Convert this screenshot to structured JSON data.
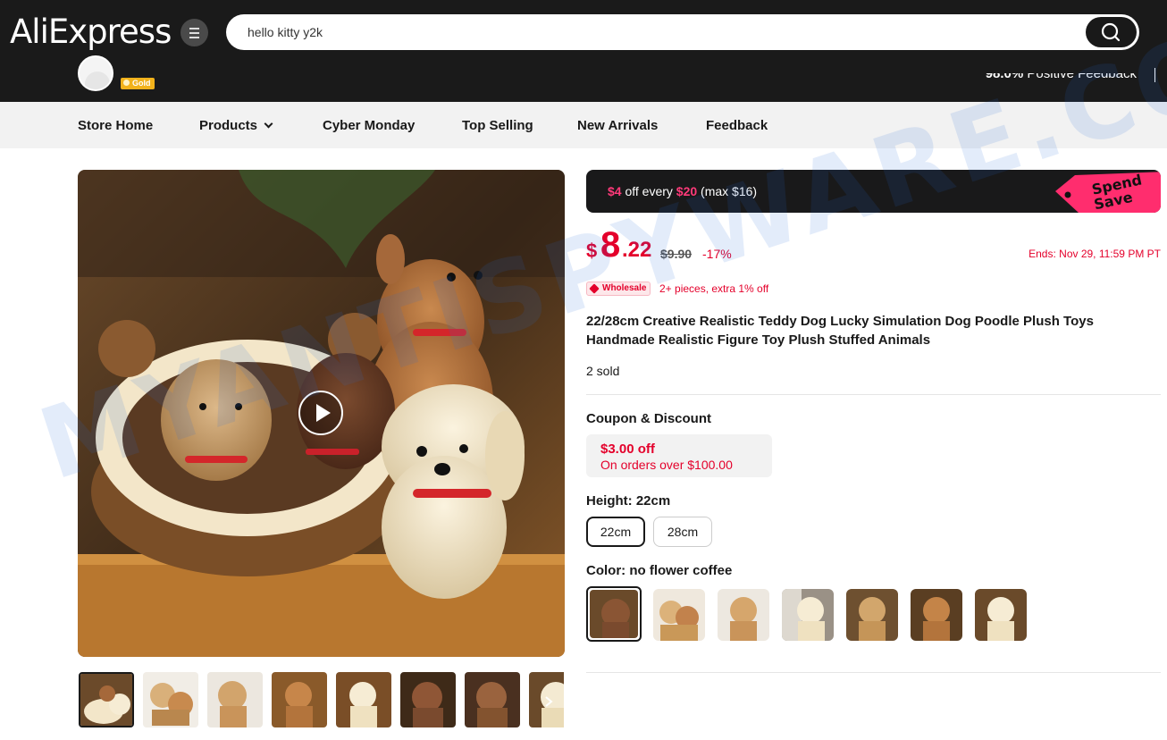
{
  "header": {
    "logo_text": "AliExpress",
    "search": {
      "value": "hello kitty y2k"
    },
    "store": {
      "gold_badge": "Gold",
      "feedback_score": "98.0%",
      "feedback_label": "Positive Feedback"
    }
  },
  "nav": {
    "items": [
      "Store Home",
      "Products",
      "Cyber Monday",
      "Top Selling",
      "New Arrivals",
      "Feedback"
    ]
  },
  "promo": {
    "prefix": "$4",
    "middle": " off every ",
    "threshold": "$20",
    "suffix": " (max $16)",
    "badge_line1": "Spend",
    "badge_line2": "Save"
  },
  "price": {
    "currency": "$",
    "integer": "8",
    "decimal": ".22",
    "original": "$9.90",
    "discount": "-17%",
    "ends_label": "Ends:",
    "ends_value": "Nov 29, 11:59 PM PT"
  },
  "wholesale": {
    "badge": "Wholesale",
    "text": "2+ pieces, extra 1% off"
  },
  "product": {
    "title": "22/28cm Creative Realistic Teddy Dog Lucky Simulation Dog Poodle Plush Toys Handmade Realistic Figure Toy Plush Stuffed Animals",
    "sold": "2 sold"
  },
  "coupon": {
    "heading": "Coupon & Discount",
    "amount": "$3.00 off",
    "condition": "On orders over $100.00"
  },
  "height": {
    "label": "Height: 22cm",
    "options": [
      "22cm",
      "28cm"
    ],
    "selected": "22cm"
  },
  "color": {
    "label": "Color: no flower coffee",
    "option_count_visible": 7
  },
  "watermark": "MYANTISPYWARE.COM",
  "colors": {
    "accent_red": "#e4002b",
    "header_bg": "#1a1a1a",
    "nav_bg": "#f2f2f2",
    "promo_pink": "#ff3a7a"
  },
  "icons": [
    "menu-icon",
    "search-icon",
    "play-icon",
    "chevron-down-icon",
    "chevron-right-icon",
    "wholesale-tag-icon"
  ]
}
